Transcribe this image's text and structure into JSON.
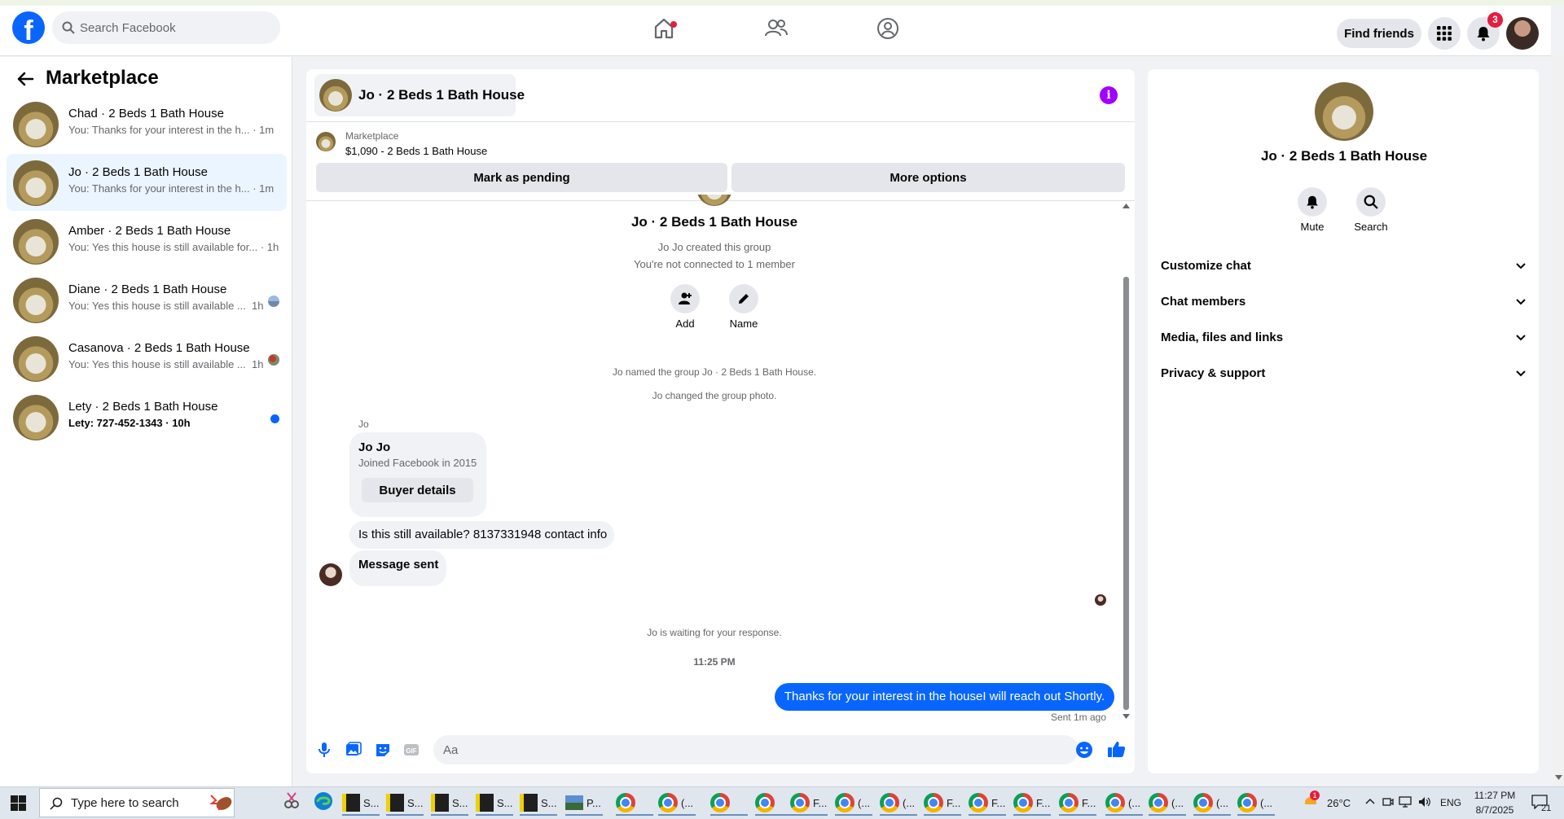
{
  "topnav": {
    "search_placeholder": "Search Facebook",
    "find_friends_label": "Find friends",
    "notifications_count": "3"
  },
  "sidebar": {
    "title": "Marketplace",
    "conversations": [
      {
        "name": "Chad · 2 Beds 1 Bath House",
        "preview": "You: Thanks for your interest in the h...",
        "time": "· 1m",
        "active": false
      },
      {
        "name": "Jo · 2 Beds 1 Bath House",
        "preview": "You: Thanks for your interest in the h...",
        "time": "· 1m",
        "active": true
      },
      {
        "name": "Amber · 2 Beds 1 Bath House",
        "preview": "You: Yes this house is still available for...",
        "time": "· 1h",
        "active": false
      },
      {
        "name": "Diane · 2 Beds 1 Bath House",
        "preview": "You: Yes this house is still available ...",
        "time": "1h",
        "active": false
      },
      {
        "name": "Casanova · 2 Beds 1 Bath House",
        "preview": "You: Yes this house is still available ...",
        "time": "1h",
        "active": false
      },
      {
        "name": "Lety · 2 Beds 1 Bath House",
        "preview": "Lety: 727-452-1343",
        "time": "· 10h",
        "active": false,
        "unread": true
      }
    ]
  },
  "chat": {
    "header_title": "Jo · 2 Beds 1 Bath House",
    "marketplace_label": "Marketplace",
    "listing": "$1,090 - 2 Beds 1 Bath House",
    "mark_pending_label": "Mark as pending",
    "more_options_label": "More options",
    "group_title": "Jo · 2 Beds 1 Bath House",
    "created_text": "Jo Jo created this group",
    "not_connected_text": "You're not connected to 1 member",
    "add_label": "Add",
    "name_label": "Name",
    "named_event": "Jo named the group Jo · 2 Beds 1 Bath House.",
    "photo_event": "Jo changed the group photo.",
    "sender_label": "Jo",
    "card_name": "Jo Jo",
    "card_joined": "Joined Facebook in 2015",
    "buyer_details_label": "Buyer details",
    "msg_available": "Is this still available? 8137331948 contact info",
    "msg_sent": "Message sent",
    "waiting_text": "Jo is waiting for your response.",
    "timestamp": "11:25 PM",
    "my_message": "Thanks for your interest in the houseI will reach out Shortly.",
    "sent_status": "Sent 1m ago",
    "composer_placeholder": "Aa"
  },
  "right_panel": {
    "name": "Jo · 2 Beds 1 Bath House",
    "mute_label": "Mute",
    "search_label": "Search",
    "sections": [
      "Customize chat",
      "Chat members",
      "Media, files and links",
      "Privacy & support"
    ]
  },
  "taskbar": {
    "search_placeholder": "Type here to search",
    "apps": [
      {
        "icon": "sticky-notes-icon",
        "label": "S..."
      },
      {
        "icon": "sticky-notes-icon",
        "label": "S..."
      },
      {
        "icon": "sticky-notes-icon",
        "label": "S..."
      },
      {
        "icon": "sticky-notes-icon",
        "label": "S..."
      },
      {
        "icon": "sticky-notes-icon",
        "label": "S..."
      },
      {
        "icon": "photos-icon",
        "label": "P..."
      },
      {
        "icon": "chrome-icon",
        "label": ""
      },
      {
        "icon": "chrome-icon",
        "label": "(..."
      },
      {
        "icon": "chrome-icon",
        "label": ""
      },
      {
        "icon": "chrome-icon",
        "label": ""
      },
      {
        "icon": "chrome-icon",
        "label": "F..."
      },
      {
        "icon": "chrome-icon",
        "label": "(..."
      },
      {
        "icon": "chrome-icon",
        "label": "(..."
      },
      {
        "icon": "chrome-icon",
        "label": "F..."
      },
      {
        "icon": "chrome-icon",
        "label": "F..."
      },
      {
        "icon": "chrome-icon",
        "label": "F..."
      },
      {
        "icon": "chrome-icon",
        "label": "F..."
      },
      {
        "icon": "chrome-icon",
        "label": "(..."
      },
      {
        "icon": "chrome-icon",
        "label": "(..."
      },
      {
        "icon": "chrome-icon",
        "label": "(..."
      },
      {
        "icon": "chrome-icon",
        "label": "(..."
      }
    ],
    "weather_alert": "1",
    "temperature": "26°C",
    "language": "ENG",
    "time": "11:27 PM",
    "date": "8/7/2025",
    "notification_count": "21"
  },
  "colors": {
    "brand": "#0866ff",
    "active_row": "#ebf5ff",
    "info": "#a100ff",
    "badge": "#e41e3f"
  }
}
